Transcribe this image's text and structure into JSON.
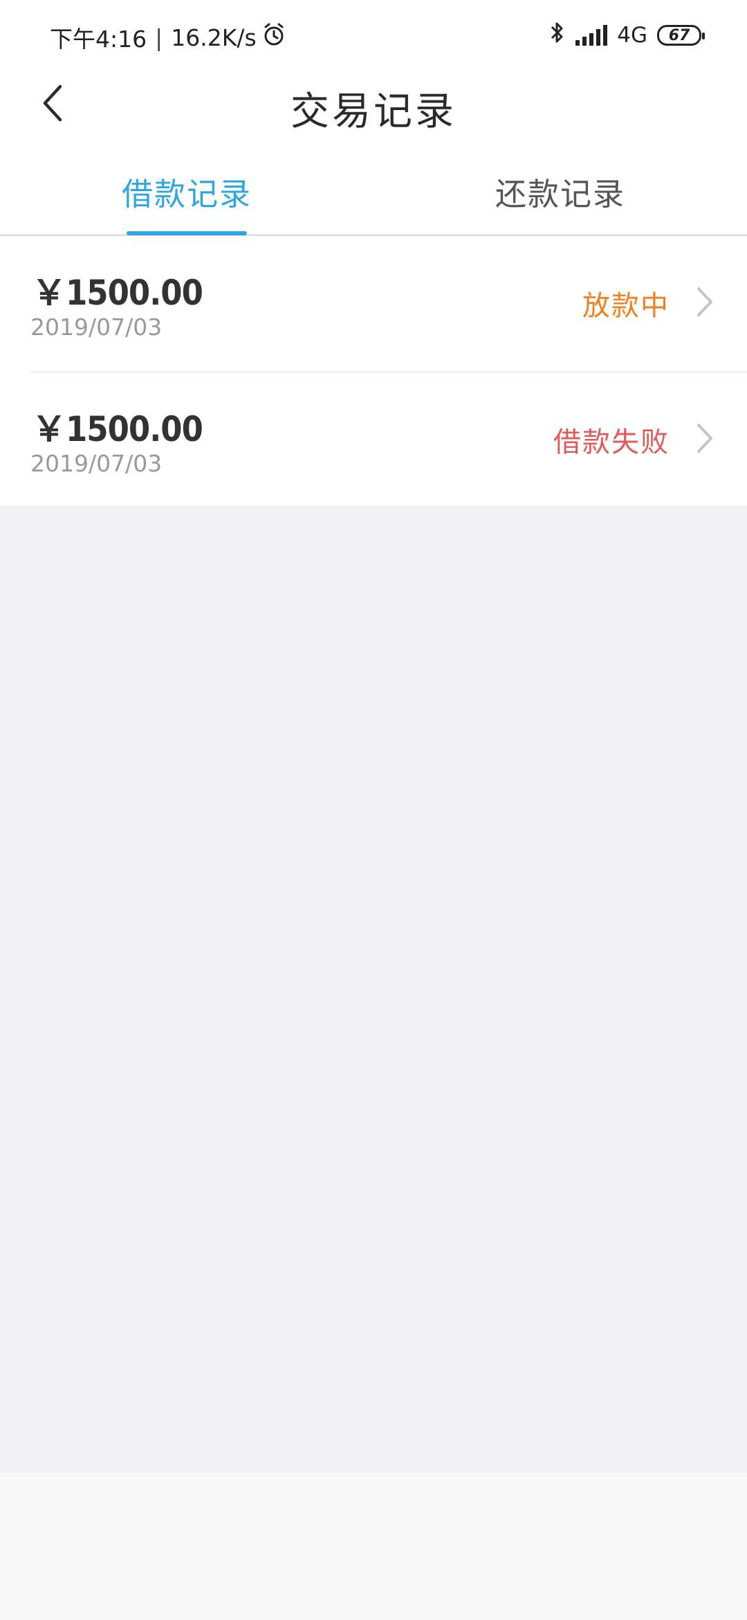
{
  "status_bar": {
    "time": "下午4:16",
    "separator": "|",
    "speed": "16.2K/s",
    "network": "4G",
    "battery": "67",
    "icons": [
      "alarm-icon",
      "bluetooth-icon",
      "signal-icon",
      "battery-icon"
    ]
  },
  "header": {
    "title": "交易记录",
    "back_icon": "chevron-left-icon"
  },
  "tabs": [
    {
      "label": "借款记录",
      "active": true
    },
    {
      "label": "还款记录",
      "active": false
    }
  ],
  "records": [
    {
      "amount": "￥1500.00",
      "date": "2019/07/03",
      "status": "放款中",
      "status_color": "#f2801e"
    },
    {
      "amount": "￥1500.00",
      "date": "2019/07/03",
      "status": "借款失败",
      "status_color": "#e05a5a"
    }
  ],
  "colors": {
    "accent": "#2ea7e0",
    "status_pending": "#f2801e",
    "status_failed": "#e05a5a"
  }
}
